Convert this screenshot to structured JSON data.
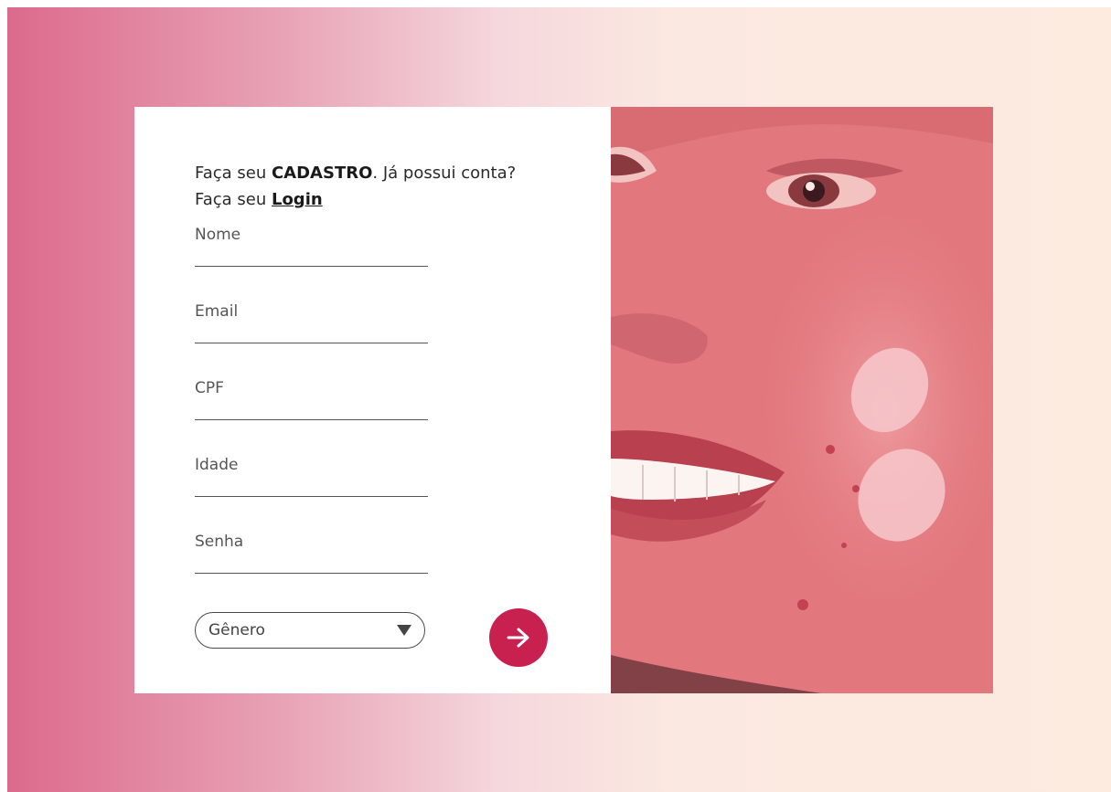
{
  "intro": {
    "line1_prefix": "Faça seu ",
    "line1_bold": "CADASTRO",
    "line1_suffix": ". Já possui conta?",
    "line2_prefix": "Faça seu ",
    "login_link": "Login"
  },
  "fields": {
    "nome": {
      "label": "Nome",
      "value": ""
    },
    "email": {
      "label": "Email",
      "value": ""
    },
    "cpf": {
      "label": "CPF",
      "value": ""
    },
    "idade": {
      "label": "Idade",
      "value": ""
    },
    "senha": {
      "label": "Senha",
      "value": ""
    }
  },
  "genero_select": {
    "selected": "Gênero"
  },
  "submit": {
    "icon": "arrow-right-icon"
  },
  "colors": {
    "accent": "#c8204f",
    "photo_tint": "#e07379",
    "gradient_left": "#dc6a8c",
    "gradient_right": "#fdebe0"
  }
}
